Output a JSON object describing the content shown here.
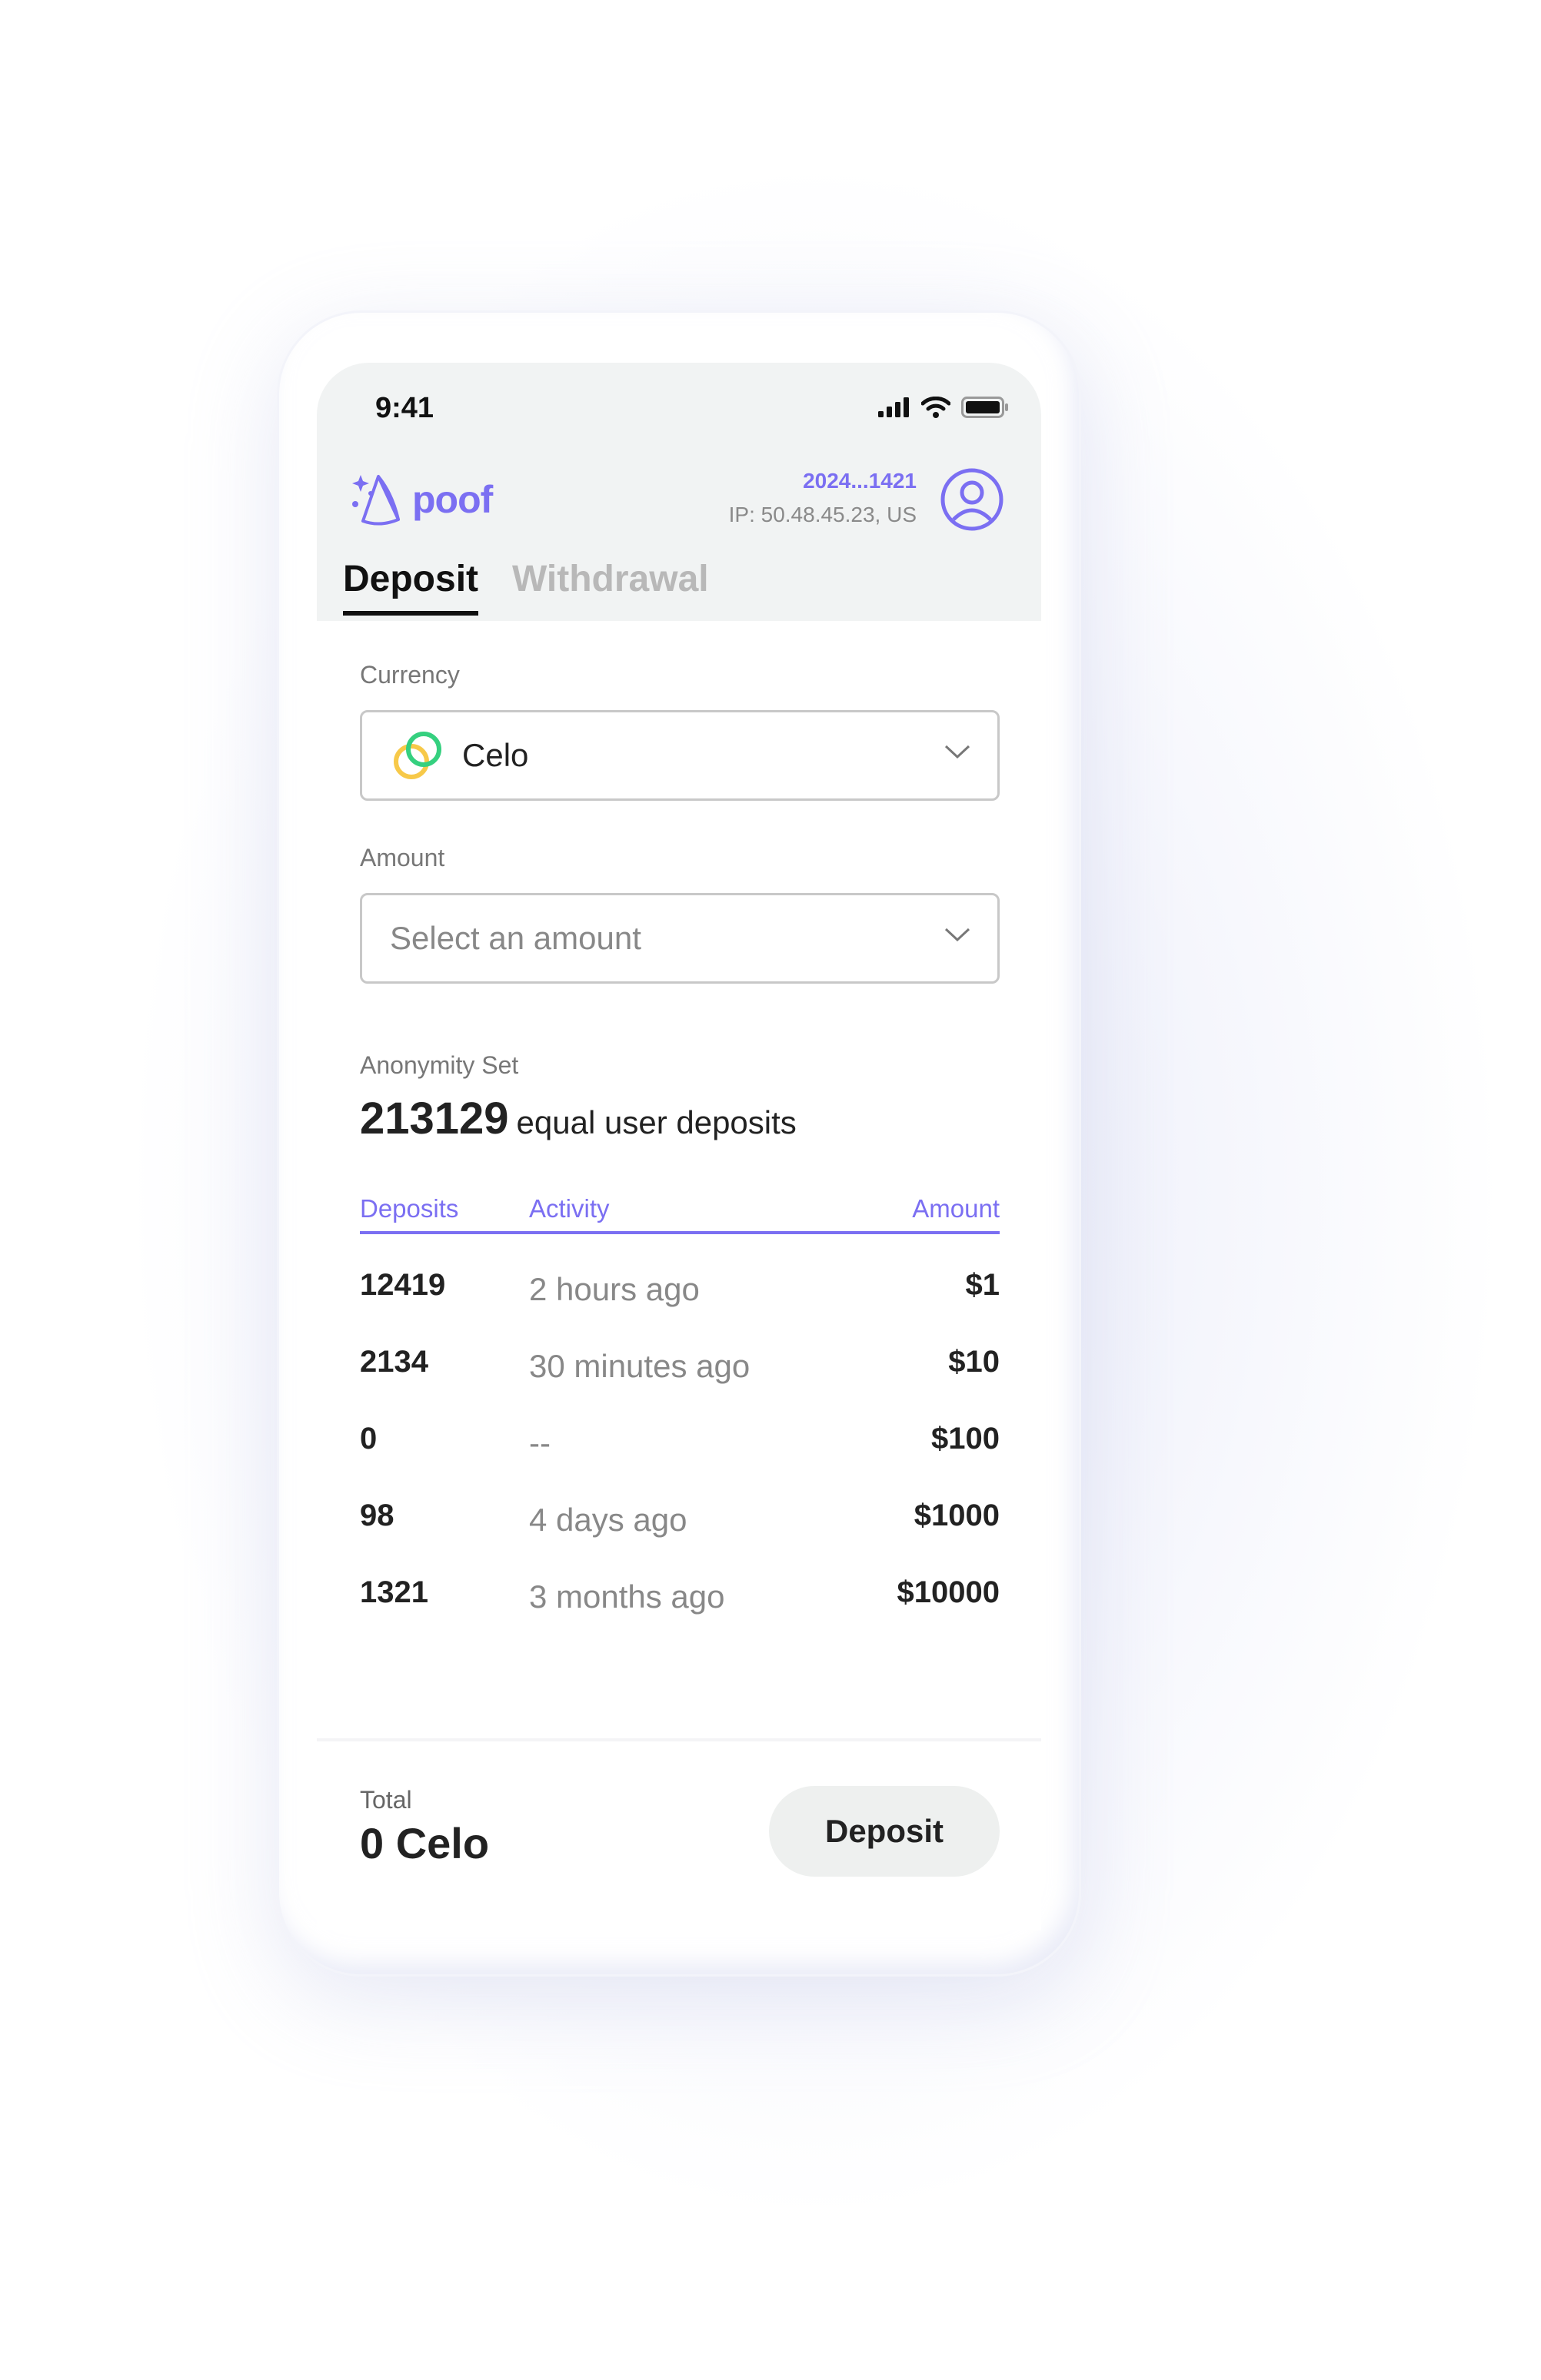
{
  "status_bar": {
    "time": "9:41"
  },
  "brand": {
    "name": "poof",
    "accent": "#7b6ff2"
  },
  "account": {
    "id": "2024...1421",
    "ip": "IP: 50.48.45.23, US"
  },
  "tabs": [
    {
      "label": "Deposit",
      "active": true
    },
    {
      "label": "Withdrawal",
      "active": false
    }
  ],
  "currency": {
    "label": "Currency",
    "value": "Celo",
    "icon": "celo-icon"
  },
  "amount": {
    "label": "Amount",
    "placeholder": "Select an amount"
  },
  "anonymity": {
    "label": "Anonymity Set",
    "count": "213129",
    "suffix": "equal user deposits"
  },
  "table": {
    "headers": {
      "deposits": "Deposits",
      "activity": "Activity",
      "amount": "Amount"
    },
    "rows": [
      {
        "deposits": "12419",
        "activity": "2 hours ago",
        "amount": "$1"
      },
      {
        "deposits": "2134",
        "activity": "30 minutes ago",
        "amount": "$10"
      },
      {
        "deposits": "0",
        "activity": "--",
        "amount": "$100"
      },
      {
        "deposits": "98",
        "activity": "4 days ago",
        "amount": "$1000"
      },
      {
        "deposits": "1321",
        "activity": "3 months ago",
        "amount": "$10000"
      }
    ]
  },
  "footer": {
    "total_label": "Total",
    "total_value": "0 Celo",
    "button_label": "Deposit"
  }
}
